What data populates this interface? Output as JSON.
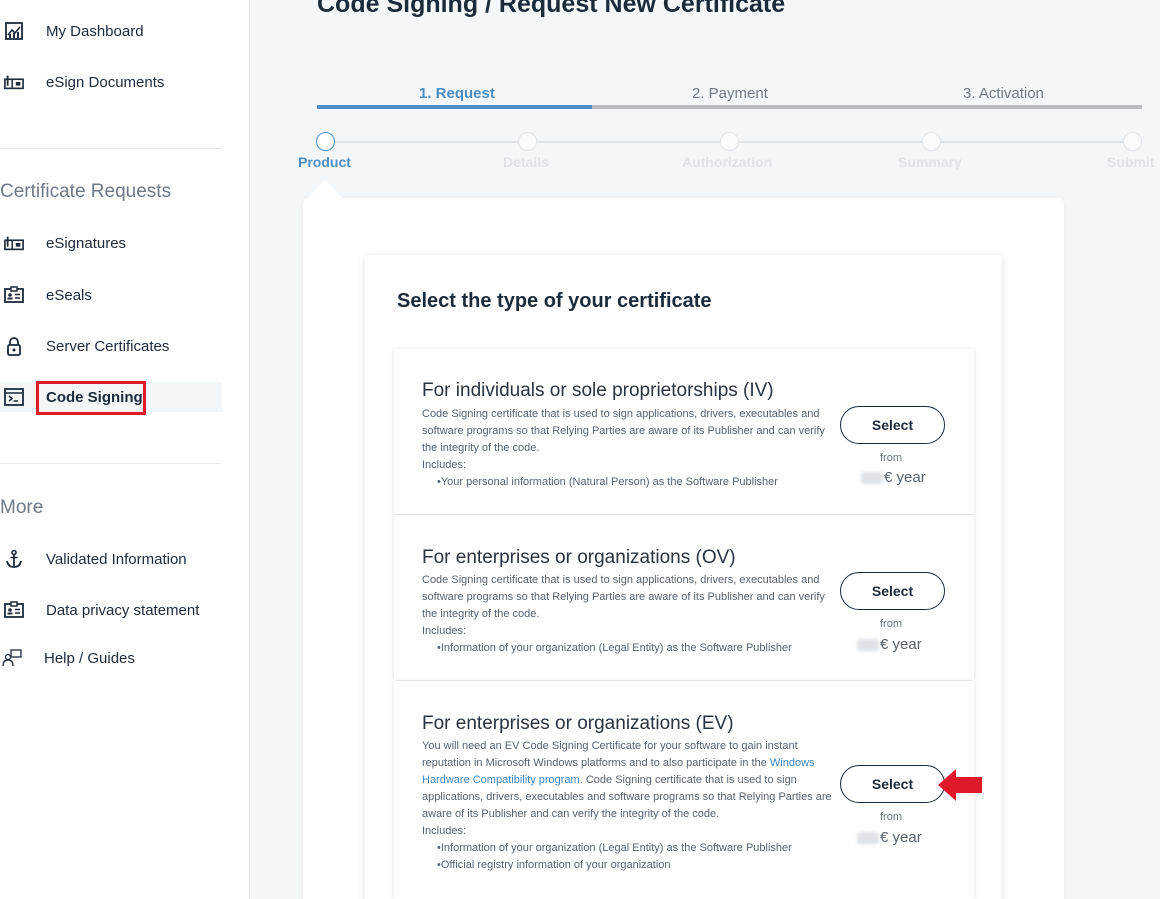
{
  "sidebar": {
    "items_top": [
      {
        "label": "My Dashboard",
        "icon": "dashboard-chart-icon"
      },
      {
        "label": "eSign Documents",
        "icon": "esign-icon"
      }
    ],
    "certificate_requests_title": "Certificate Requests",
    "cert_items": [
      {
        "label": "eSignatures",
        "icon": "esign-icon"
      },
      {
        "label": "eSeals",
        "icon": "id-card-icon"
      },
      {
        "label": "Server Certificates",
        "icon": "lock-icon"
      },
      {
        "label": "Code Signing",
        "icon": "terminal-window-icon"
      }
    ],
    "more_title": "More",
    "more_items": [
      {
        "label": "Validated Information",
        "icon": "anchor-icon"
      },
      {
        "label": "Data privacy statement",
        "icon": "id-card-icon"
      },
      {
        "label": "Help / Guides",
        "icon": "help-guides-icon"
      }
    ]
  },
  "page_title": "Code Signing / Request New Certificate",
  "steps": [
    "1. Request",
    "2. Payment",
    "3. Activation"
  ],
  "substeps": [
    "Product",
    "Details",
    "Authorization",
    "Summary",
    "Submit"
  ],
  "inner_title": "Select the type of your certificate",
  "options": [
    {
      "title": "For individuals or sole proprietorships (IV)",
      "desc": "Code Signing certificate that is used to sign applications, drivers, executables and software programs so that Relying Parties are aware of its Publisher and can verify the integrity of the code.",
      "includes_label": "Includes:",
      "includes": [
        "•Your personal information (Natural Person) as the Software Publisher"
      ],
      "button": "Select",
      "from": "from",
      "price_unit": "€ year"
    },
    {
      "title": "For enterprises or organizations (OV)",
      "desc": "Code Signing certificate that is used to sign applications, drivers, executables and software programs so that Relying Parties are aware of its Publisher and can verify the integrity of the code.",
      "includes_label": "Includes:",
      "includes": [
        "•Information of your organization (Legal Entity) as the Software Publisher"
      ],
      "button": "Select",
      "from": "from",
      "price_unit": "€ year"
    },
    {
      "title": "For enterprises or organizations (EV)",
      "desc_pre": "You will need an EV Code Signing Certificate for your software to gain instant reputation in Microsoft Windows platforms and to also participate in the ",
      "desc_link": "Windows Hardware Compatibility program",
      "desc_post": ". Code Signing certificate that is used to sign applications, drivers, executables and software programs so that Relying Parties are aware of its Publisher and can verify the integrity of the code.",
      "includes_label": "Includes:",
      "includes": [
        "•Information of your organization (Legal Entity) as the Software Publisher",
        "•Official registry information of your organization"
      ],
      "button": "Select",
      "from": "from",
      "price_unit": "€ year"
    }
  ],
  "colors": {
    "accent": "#4d8ec4",
    "highlight": "#e0192a"
  }
}
